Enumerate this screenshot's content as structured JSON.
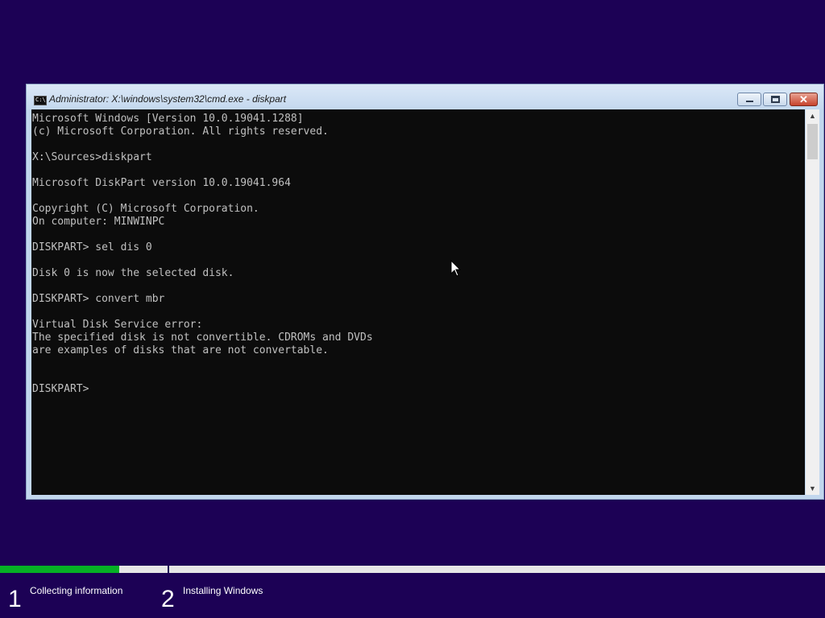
{
  "window": {
    "title": "Administrator: X:\\windows\\system32\\cmd.exe - diskpart",
    "icon": "cmd-icon",
    "icon_text": "C:\\",
    "close_glyph": "✕"
  },
  "console": {
    "lines": [
      "Microsoft Windows [Version 10.0.19041.1288]",
      "(c) Microsoft Corporation. All rights reserved.",
      "",
      "X:\\Sources>diskpart",
      "",
      "Microsoft DiskPart version 10.0.19041.964",
      "",
      "Copyright (C) Microsoft Corporation.",
      "On computer: MINWINPC",
      "",
      "DISKPART> sel dis 0",
      "",
      "Disk 0 is now the selected disk.",
      "",
      "DISKPART> convert mbr",
      "",
      "Virtual Disk Service error:",
      "The specified disk is not convertible. CDROMs and DVDs",
      "are examples of disks that are not convertable.",
      "",
      "",
      "DISKPART> "
    ]
  },
  "scrollbar": {
    "up_arrow": "▲",
    "down_arrow": "▼"
  },
  "setup": {
    "progress": 0.71,
    "steps": [
      {
        "number": "1",
        "label": "Collecting information"
      },
      {
        "number": "2",
        "label": "Installing Windows"
      }
    ]
  },
  "colors": {
    "background": "#1c0155",
    "progress_fill": "#06b025",
    "console_text": "#c0c0c0"
  }
}
